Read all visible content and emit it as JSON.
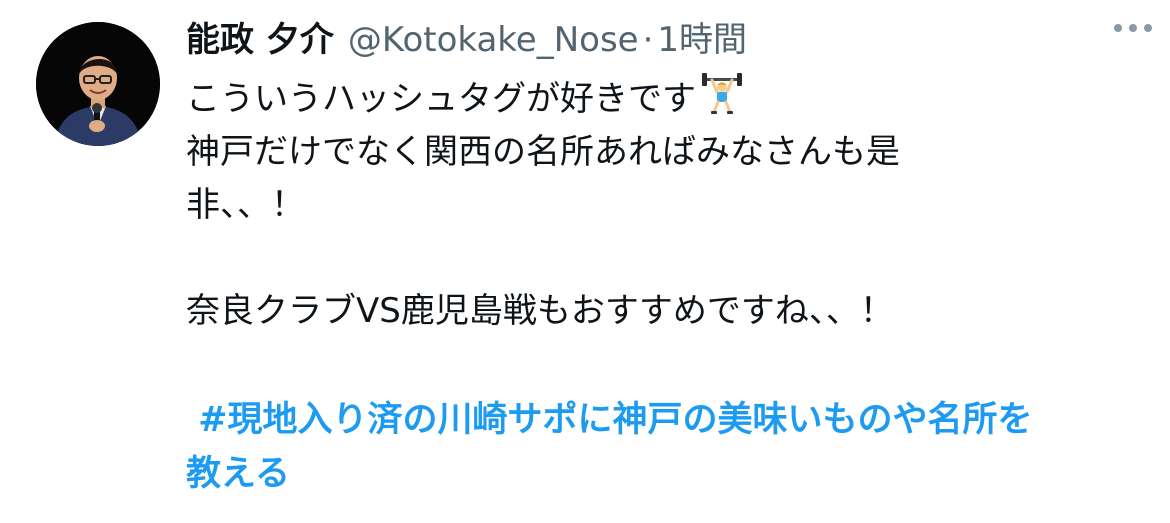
{
  "tweet": {
    "author": {
      "display_name": "能政 夕介",
      "handle": "@Kotokake_Nose",
      "separator": "·",
      "time": "1時間"
    },
    "more_icon": "more-horizontal-icon",
    "body_lines": [
      "こういうハッシュタグが好きです",
      "神戸だけでなく関西の名所あればみなさんも是",
      "非、、！",
      "奈良クラブVS鹿児島戦もおすすめですね、、！"
    ],
    "emoji": "weightlifter-emoji",
    "hashtag_lines": [
      " #現地入り済の川崎サポに神戸の美味いものや名所を",
      "教える"
    ],
    "colors": {
      "hashtag": "#1d9bf0",
      "secondary_text": "#536471",
      "primary_text": "#0f1419"
    }
  }
}
